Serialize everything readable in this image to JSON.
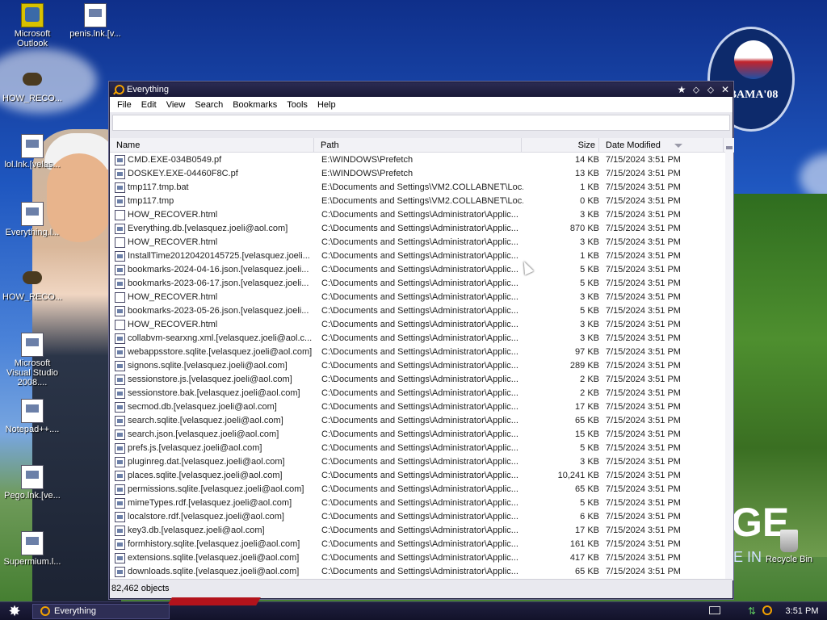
{
  "desktop": {
    "icons": [
      {
        "label": "Microsoft Outlook",
        "kind": "outlook"
      },
      {
        "label": "penis.lnk.[v...",
        "kind": "doc"
      },
      {
        "label": "HOW_RECO...",
        "kind": "badger"
      },
      {
        "label": "lol.lnk.[velas...",
        "kind": "doc"
      },
      {
        "label": "Everything.l...",
        "kind": "doc"
      },
      {
        "label": "HOW_RECO...",
        "kind": "badger"
      },
      {
        "label": "Microsoft Visual Studio 2008....",
        "kind": "doc"
      },
      {
        "label": "Notepad++....",
        "kind": "doc"
      },
      {
        "label": "Pego.lnk.[ve...",
        "kind": "doc"
      },
      {
        "label": "Supermium.l...",
        "kind": "doc"
      }
    ],
    "recycle_bin": "Recycle Bin",
    "wallpaper_badge": "BAMA'08",
    "wallpaper_slogan": "GE",
    "wallpaper_slogan_small": "E IN"
  },
  "window": {
    "title": "Everything",
    "menu": [
      "File",
      "Edit",
      "View",
      "Search",
      "Bookmarks",
      "Tools",
      "Help"
    ],
    "search_value": "",
    "columns": {
      "name": "Name",
      "path": "Path",
      "size": "Size",
      "date": "Date Modified"
    },
    "status": "82,462 objects",
    "rows": [
      {
        "name": "CMD.EXE-034B0549.pf",
        "path": "E:\\WINDOWS\\Prefetch",
        "size": "14 KB",
        "date": "7/15/2024 3:51 PM"
      },
      {
        "name": "DOSKEY.EXE-04460F8C.pf",
        "path": "E:\\WINDOWS\\Prefetch",
        "size": "13 KB",
        "date": "7/15/2024 3:51 PM"
      },
      {
        "name": "tmp117.tmp.bat",
        "path": "E:\\Documents and Settings\\VM2.COLLABNET\\Loc...",
        "size": "1 KB",
        "date": "7/15/2024 3:51 PM"
      },
      {
        "name": "tmp117.tmp",
        "path": "E:\\Documents and Settings\\VM2.COLLABNET\\Loc...",
        "size": "0 KB",
        "date": "7/15/2024 3:51 PM"
      },
      {
        "name": "HOW_RECOVER.html",
        "path": "C:\\Documents and Settings\\Administrator\\Applic...",
        "size": "3 KB",
        "date": "7/15/2024 3:51 PM"
      },
      {
        "name": "Everything.db.[velasquez.joeli@aol.com]",
        "path": "C:\\Documents and Settings\\Administrator\\Applic...",
        "size": "870 KB",
        "date": "7/15/2024 3:51 PM"
      },
      {
        "name": "HOW_RECOVER.html",
        "path": "C:\\Documents and Settings\\Administrator\\Applic...",
        "size": "3 KB",
        "date": "7/15/2024 3:51 PM"
      },
      {
        "name": "InstallTime20120420145725.[velasquez.joeli...",
        "path": "C:\\Documents and Settings\\Administrator\\Applic...",
        "size": "1 KB",
        "date": "7/15/2024 3:51 PM"
      },
      {
        "name": "bookmarks-2024-04-16.json.[velasquez.joeli...",
        "path": "C:\\Documents and Settings\\Administrator\\Applic...",
        "size": "5 KB",
        "date": "7/15/2024 3:51 PM"
      },
      {
        "name": "bookmarks-2023-06-17.json.[velasquez.joeli...",
        "path": "C:\\Documents and Settings\\Administrator\\Applic...",
        "size": "5 KB",
        "date": "7/15/2024 3:51 PM"
      },
      {
        "name": "HOW_RECOVER.html",
        "path": "C:\\Documents and Settings\\Administrator\\Applic...",
        "size": "3 KB",
        "date": "7/15/2024 3:51 PM"
      },
      {
        "name": "bookmarks-2023-05-26.json.[velasquez.joeli...",
        "path": "C:\\Documents and Settings\\Administrator\\Applic...",
        "size": "5 KB",
        "date": "7/15/2024 3:51 PM"
      },
      {
        "name": "HOW_RECOVER.html",
        "path": "C:\\Documents and Settings\\Administrator\\Applic...",
        "size": "3 KB",
        "date": "7/15/2024 3:51 PM"
      },
      {
        "name": "collabvm-searxng.xml.[velasquez.joeli@aol.c...",
        "path": "C:\\Documents and Settings\\Administrator\\Applic...",
        "size": "3 KB",
        "date": "7/15/2024 3:51 PM"
      },
      {
        "name": "webappsstore.sqlite.[velasquez.joeli@aol.com]",
        "path": "C:\\Documents and Settings\\Administrator\\Applic...",
        "size": "97 KB",
        "date": "7/15/2024 3:51 PM"
      },
      {
        "name": "signons.sqlite.[velasquez.joeli@aol.com]",
        "path": "C:\\Documents and Settings\\Administrator\\Applic...",
        "size": "289 KB",
        "date": "7/15/2024 3:51 PM"
      },
      {
        "name": "sessionstore.js.[velasquez.joeli@aol.com]",
        "path": "C:\\Documents and Settings\\Administrator\\Applic...",
        "size": "2 KB",
        "date": "7/15/2024 3:51 PM"
      },
      {
        "name": "sessionstore.bak.[velasquez.joeli@aol.com]",
        "path": "C:\\Documents and Settings\\Administrator\\Applic...",
        "size": "2 KB",
        "date": "7/15/2024 3:51 PM"
      },
      {
        "name": "secmod.db.[velasquez.joeli@aol.com]",
        "path": "C:\\Documents and Settings\\Administrator\\Applic...",
        "size": "17 KB",
        "date": "7/15/2024 3:51 PM"
      },
      {
        "name": "search.sqlite.[velasquez.joeli@aol.com]",
        "path": "C:\\Documents and Settings\\Administrator\\Applic...",
        "size": "65 KB",
        "date": "7/15/2024 3:51 PM"
      },
      {
        "name": "search.json.[velasquez.joeli@aol.com]",
        "path": "C:\\Documents and Settings\\Administrator\\Applic...",
        "size": "15 KB",
        "date": "7/15/2024 3:51 PM"
      },
      {
        "name": "prefs.js.[velasquez.joeli@aol.com]",
        "path": "C:\\Documents and Settings\\Administrator\\Applic...",
        "size": "5 KB",
        "date": "7/15/2024 3:51 PM"
      },
      {
        "name": "pluginreg.dat.[velasquez.joeli@aol.com]",
        "path": "C:\\Documents and Settings\\Administrator\\Applic...",
        "size": "3 KB",
        "date": "7/15/2024 3:51 PM"
      },
      {
        "name": "places.sqlite.[velasquez.joeli@aol.com]",
        "path": "C:\\Documents and Settings\\Administrator\\Applic...",
        "size": "10,241 KB",
        "date": "7/15/2024 3:51 PM"
      },
      {
        "name": "permissions.sqlite.[velasquez.joeli@aol.com]",
        "path": "C:\\Documents and Settings\\Administrator\\Applic...",
        "size": "65 KB",
        "date": "7/15/2024 3:51 PM"
      },
      {
        "name": "mimeTypes.rdf.[velasquez.joeli@aol.com]",
        "path": "C:\\Documents and Settings\\Administrator\\Applic...",
        "size": "5 KB",
        "date": "7/15/2024 3:51 PM"
      },
      {
        "name": "localstore.rdf.[velasquez.joeli@aol.com]",
        "path": "C:\\Documents and Settings\\Administrator\\Applic...",
        "size": "6 KB",
        "date": "7/15/2024 3:51 PM"
      },
      {
        "name": "key3.db.[velasquez.joeli@aol.com]",
        "path": "C:\\Documents and Settings\\Administrator\\Applic...",
        "size": "17 KB",
        "date": "7/15/2024 3:51 PM"
      },
      {
        "name": "formhistory.sqlite.[velasquez.joeli@aol.com]",
        "path": "C:\\Documents and Settings\\Administrator\\Applic...",
        "size": "161 KB",
        "date": "7/15/2024 3:51 PM"
      },
      {
        "name": "extensions.sqlite.[velasquez.joeli@aol.com]",
        "path": "C:\\Documents and Settings\\Administrator\\Applic...",
        "size": "417 KB",
        "date": "7/15/2024 3:51 PM"
      },
      {
        "name": "downloads.sqlite.[velasquez.joeli@aol.com]",
        "path": "C:\\Documents and Settings\\Administrator\\Applic...",
        "size": "65 KB",
        "date": "7/15/2024 3:51 PM"
      }
    ]
  },
  "taskbar": {
    "task_label": "Everything",
    "clock": "3:51 PM"
  }
}
